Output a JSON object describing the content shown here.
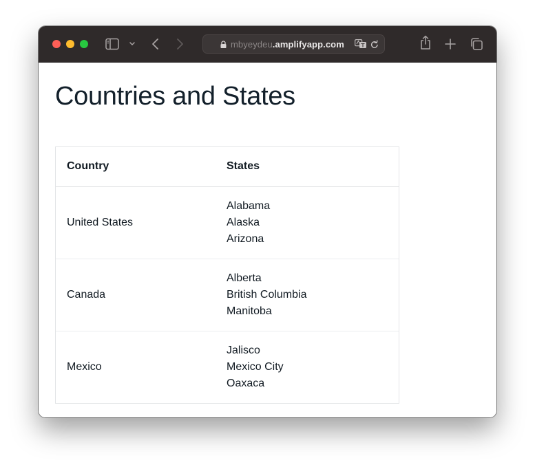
{
  "browser": {
    "url_faded": "mbyeydeu",
    "url_domain": ".amplifyapp.com",
    "icons": {
      "sidebar": "sidebar-icon",
      "chevron": "chevron-down-icon",
      "back": "back-icon",
      "forward": "forward-icon",
      "lock": "lock-icon",
      "translate": "translate-icon",
      "reload": "reload-icon",
      "share": "share-icon",
      "new_tab": "plus-icon",
      "tabs": "tab-overview-icon"
    }
  },
  "page": {
    "title": "Countries and States",
    "table": {
      "headers": [
        "Country",
        "States"
      ],
      "rows": [
        {
          "country": "United States",
          "states": [
            "Alabama",
            "Alaska",
            "Arizona"
          ]
        },
        {
          "country": "Canada",
          "states": [
            "Alberta",
            "British Columbia",
            "Manitoba"
          ]
        },
        {
          "country": "Mexico",
          "states": [
            "Jalisco",
            "Mexico City",
            "Oaxaca"
          ]
        }
      ]
    }
  }
}
